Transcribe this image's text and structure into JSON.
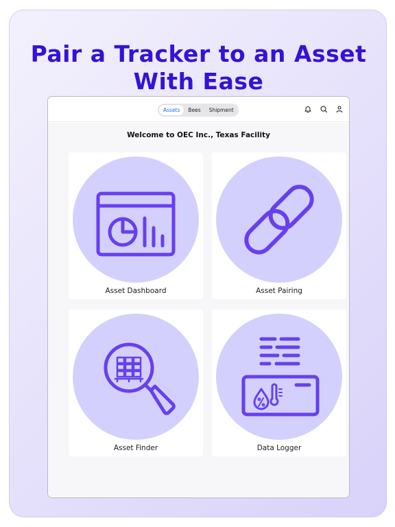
{
  "promo": {
    "headline_line1": "Pair a Tracker to an Asset",
    "headline_line2": "With Ease"
  },
  "tabs": [
    {
      "label": "Assets",
      "active": true
    },
    {
      "label": "Bees",
      "active": false
    },
    {
      "label": "Shipment",
      "active": false
    }
  ],
  "top_icons": [
    "bell-icon",
    "search-icon",
    "user-icon"
  ],
  "welcome": "Welcome to OEC Inc., Texas Facility",
  "cards": [
    {
      "label": "Asset Dashboard",
      "icon": "dashboard-chart-icon"
    },
    {
      "label": "Asset Pairing",
      "icon": "chain-link-icon"
    },
    {
      "label": "Asset Finder",
      "icon": "magnifier-pallet-icon"
    },
    {
      "label": "Data Logger",
      "icon": "data-logger-icon"
    }
  ],
  "colors": {
    "headline": "#3412d8",
    "icon_stroke": "#6640f0",
    "circle_fill": "#d4d0fd",
    "active_tab": "#1e6ff0"
  }
}
